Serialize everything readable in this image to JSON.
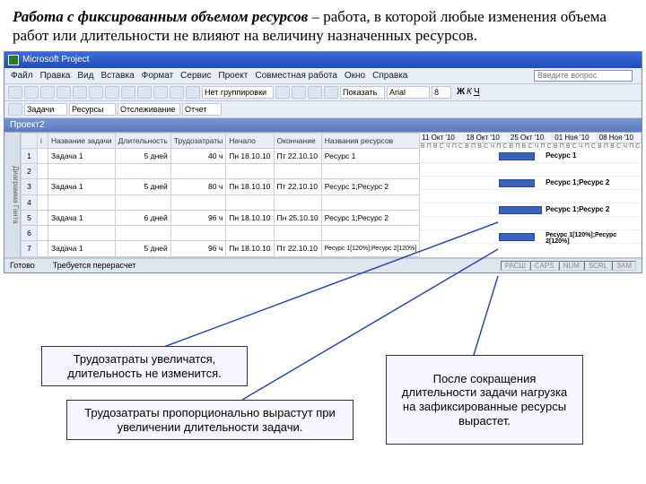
{
  "explain": {
    "term": "Работа с фиксированным объемом ресурсов",
    "rest": " – работа, в которой любые изменения объема работ или длительности не влияют на величину назначенных ресурсов."
  },
  "app": {
    "title": "Microsoft Project",
    "questionPlaceholder": "Введите вопрос"
  },
  "menus": [
    "Файл",
    "Правка",
    "Вид",
    "Вставка",
    "Формат",
    "Сервис",
    "Проект",
    "Совместная работа",
    "Окно",
    "Справка"
  ],
  "tb1": {
    "grouping": "Нет группировки",
    "show": "Показать",
    "font": "Arial",
    "size": "8",
    "bold": "Ж",
    "italic": "К",
    "underline": "Ч"
  },
  "tb2": {
    "tasks": "Задачи",
    "resources": "Ресурсы",
    "tracking": "Отслеживание",
    "report": "Отчет"
  },
  "project": {
    "title": "Проект2"
  },
  "columns": {
    "info": "i",
    "name": "Название задачи",
    "duration": "Длительность",
    "work": "Трудозатраты",
    "start": "Начало",
    "finish": "Окончание",
    "resources": "Названия ресурсов"
  },
  "rows": [
    {
      "n": "1",
      "name": "Задача 1",
      "dur": "5 дней",
      "work": "40 ч",
      "start": "Пн 18.10.10",
      "fin": "Пт 22.10.10",
      "res": "Ресурс 1"
    },
    {
      "n": "2",
      "name": "",
      "dur": "",
      "work": "",
      "start": "",
      "fin": "",
      "res": ""
    },
    {
      "n": "3",
      "name": "Задача 1",
      "dur": "5 дней",
      "work": "80 ч",
      "start": "Пн 18.10.10",
      "fin": "Пт 22.10.10",
      "res": "Ресурс 1;Ресурс 2"
    },
    {
      "n": "4",
      "name": "",
      "dur": "",
      "work": "",
      "start": "",
      "fin": "",
      "res": ""
    },
    {
      "n": "5",
      "name": "Задача 1",
      "dur": "6 дней",
      "work": "96 ч",
      "start": "Пн 18.10.10",
      "fin": "Пн 25.10.10",
      "res": "Ресурс 1;Ресурс 2"
    },
    {
      "n": "6",
      "name": "",
      "dur": "",
      "work": "",
      "start": "",
      "fin": "",
      "res": ""
    },
    {
      "n": "7",
      "name": "Задача 1",
      "dur": "5 дней",
      "work": "96 ч",
      "start": "Пн 18.10.10",
      "fin": "Пт 22.10.10",
      "res": "Ресурс 1[120%];Ресурс 2[120%]"
    }
  ],
  "ganttDates": [
    "11 Окт '10",
    "18 Окт '10",
    "25 Окт '10",
    "01 Ноя '10",
    "08 Ноя '10"
  ],
  "ganttDays": [
    "В",
    "П",
    "В",
    "С",
    "Ч",
    "П",
    "С",
    "В",
    "П",
    "В",
    "С",
    "Ч",
    "П",
    "С",
    "В",
    "П",
    "В",
    "С",
    "Ч",
    "П",
    "С",
    "В",
    "П",
    "В",
    "С",
    "Ч",
    "П",
    "С",
    "В",
    "П",
    "В",
    "С",
    "Ч",
    "П",
    "С",
    "В"
  ],
  "ganttLabels": {
    "r1": "Ресурс 1",
    "r3": "Ресурс 1;Ресурс 2",
    "r5": "Ресурс 1;Ресурс 2",
    "r7": "Ресурс 1[120%];Ресурс 2[120%]"
  },
  "sideLabel": "Диаграмма Ганта",
  "status": {
    "ready": "Готово",
    "recalc": "Требуется перерасчет",
    "cells": [
      "РАСШ",
      "CAPS",
      "NUM",
      "SCRL",
      "ЗАМ"
    ]
  },
  "callouts": {
    "c1": "Трудозатраты увеличатся, длительность не изменится.",
    "c2": "Трудозатраты пропорционально вырастут при увеличении длительности задачи.",
    "c3": "После сокращения длительности задачи нагрузка на зафиксированные ресурсы вырастет."
  }
}
